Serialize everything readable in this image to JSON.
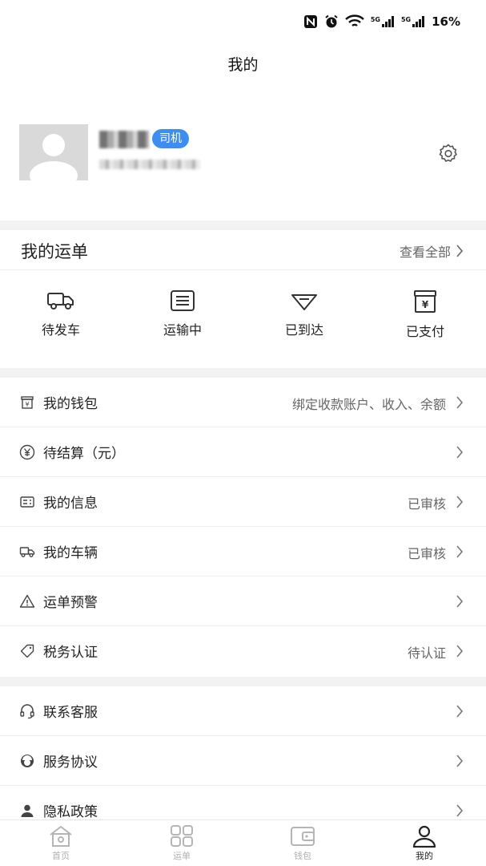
{
  "status_bar": {
    "battery": "16%",
    "net1": "5G",
    "net2": "5G"
  },
  "header": {
    "title": "我的"
  },
  "profile": {
    "role_badge": "司机"
  },
  "orders": {
    "title": "我的运单",
    "view_all": "查看全部",
    "items": [
      {
        "label": "待发车",
        "icon": "truck-icon"
      },
      {
        "label": "运输中",
        "icon": "list-icon"
      },
      {
        "label": "已到达",
        "icon": "arrival-icon"
      },
      {
        "label": "已支付",
        "icon": "paid-icon"
      }
    ]
  },
  "menu1": [
    {
      "label": "我的钱包",
      "value": "绑定收款账户、收入、余额",
      "icon": "wallet-icon"
    },
    {
      "label": "待结算（元）",
      "value": "",
      "icon": "yuan-icon"
    },
    {
      "label": "我的信息",
      "value": "已审核",
      "icon": "id-card-icon"
    },
    {
      "label": "我的车辆",
      "value": "已审核",
      "icon": "vehicle-icon"
    },
    {
      "label": "运单预警",
      "value": "",
      "icon": "warning-icon"
    },
    {
      "label": "税务认证",
      "value": "待认证",
      "icon": "tag-icon"
    }
  ],
  "menu2": [
    {
      "label": "联系客服",
      "value": "",
      "icon": "headset-icon"
    },
    {
      "label": "服务协议",
      "value": "",
      "icon": "agreement-icon"
    },
    {
      "label": "隐私政策",
      "value": "",
      "icon": "privacy-icon"
    }
  ],
  "tabbar": [
    {
      "label": "首页",
      "icon": "home-icon",
      "active": false
    },
    {
      "label": "运单",
      "icon": "grid-icon",
      "active": false
    },
    {
      "label": "钱包",
      "icon": "wallet-tab-icon",
      "active": false
    },
    {
      "label": "我的",
      "icon": "user-icon",
      "active": true
    }
  ],
  "colors": {
    "accent": "#3d8ef0",
    "divider": "#f2f2f2",
    "text": "#222222",
    "secondary": "#666666"
  }
}
